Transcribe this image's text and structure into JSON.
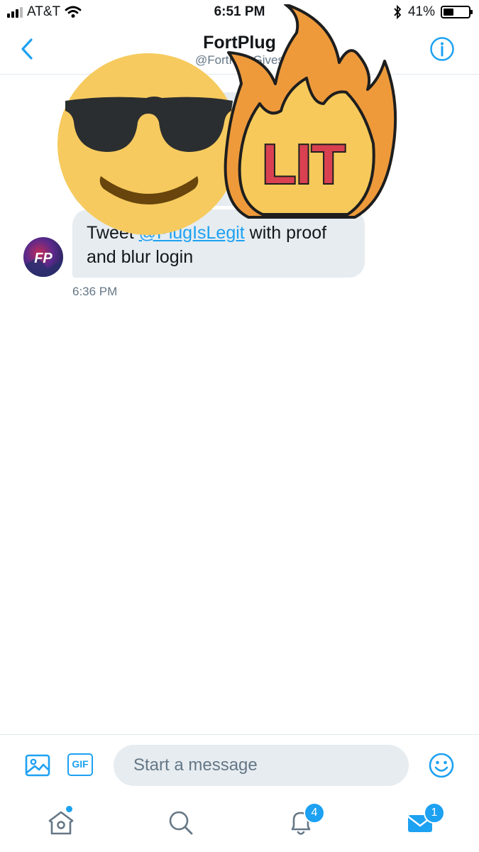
{
  "status_bar": {
    "carrier": "AT&T",
    "time": "6:51 PM",
    "battery": "41%"
  },
  "battery_level": 0.41,
  "header": {
    "title": "FortPlug",
    "handle": "@FortPlugGives"
  },
  "messages": [
    {
      "text_before": "Tweet ",
      "mention": "@PlugIsLegit",
      "text_after": " with proof and blur login",
      "time": "6:36 PM"
    }
  ],
  "avatar": {
    "initials": "FP"
  },
  "stickers": {
    "lit_text": "LIT"
  },
  "composer": {
    "placeholder": "Start a message",
    "gif_label": "GIF"
  },
  "tab_bar": {
    "notifications_badge": "4",
    "messages_badge": "1"
  },
  "colors": {
    "accent": "#1da1f2",
    "bubble": "#e6ecf0",
    "muted": "#657786"
  }
}
